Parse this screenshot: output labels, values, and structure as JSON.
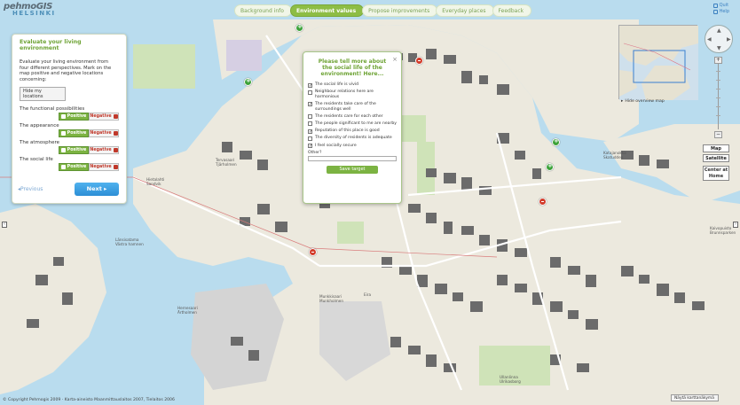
{
  "app": {
    "logo_top": "pehmoGIS",
    "logo_bottom": "HELSINKI"
  },
  "steps": [
    {
      "label": "Background info",
      "active": false
    },
    {
      "label": "Environment values",
      "active": true
    },
    {
      "label": "Propose improvements",
      "active": false
    },
    {
      "label": "Everyday places",
      "active": false
    },
    {
      "label": "Feedback",
      "active": false
    }
  ],
  "toplinks": {
    "quit": "Quit",
    "help": "Help"
  },
  "leftpanel": {
    "title": "Evaluate your living environment",
    "description": "Evaluate your living environment from four different perspectives. Mark on the map positive and negative locations concerning:",
    "hide_button": "Hide my locations",
    "categories": [
      {
        "label": "The functional possibilities"
      },
      {
        "label": "The appearance"
      },
      {
        "label": "The atmosphere"
      },
      {
        "label": "The social life"
      }
    ],
    "positive_label": "Positive",
    "negative_label": "Negative",
    "previous_label": "Previous",
    "next_label": "Next"
  },
  "popup": {
    "title": "Please tell more about the social life of the environment! Here...",
    "options": [
      {
        "label": "The social life is vivid",
        "checked": true
      },
      {
        "label": "Neighbour relations here are harmonious",
        "checked": false
      },
      {
        "label": "The residents take care of the surroundings well",
        "checked": true
      },
      {
        "label": "The residents care for each other",
        "checked": false
      },
      {
        "label": "The people significant to me are nearby",
        "checked": false
      },
      {
        "label": "Reputation of this place is good",
        "checked": true
      },
      {
        "label": "The diversity of residents is adequate",
        "checked": false
      },
      {
        "label": "I feel socially secure",
        "checked": true
      }
    ],
    "other_label": "Other?",
    "other_value": "",
    "save_label": "Save target"
  },
  "overview": {
    "hide_label": "Hide overview map"
  },
  "map_types": {
    "map": "Map",
    "satellite": "Satellite",
    "center_home": "Center at Home"
  },
  "footer": {
    "copyright": "© Copyright Pehmogis 2009 · Karta-aineisto Maanmittauslaitos 2007, Tielaitos 2006",
    "sidebar_button": "Näytä karttanäkymä"
  },
  "map_labels": [
    "Munkkisaari",
    "Munkholmen",
    "Hietalahti",
    "Sandvik",
    "Tervasaari",
    "Tjärholmen",
    "Katajanokka",
    "Skatudden",
    "Kaivopuisto",
    "Brunnsparken",
    "Eira",
    "Hernesaari",
    "Ärtholmen",
    "Länsisatama",
    "Västra hamnen",
    "Ullanlinna",
    "Ulrikasborg"
  ],
  "colors": {
    "accent": "#8dbd45",
    "water": "#b7dcee",
    "land": "#ece9de",
    "positive": "#7cb342",
    "negative": "#c0392b"
  }
}
